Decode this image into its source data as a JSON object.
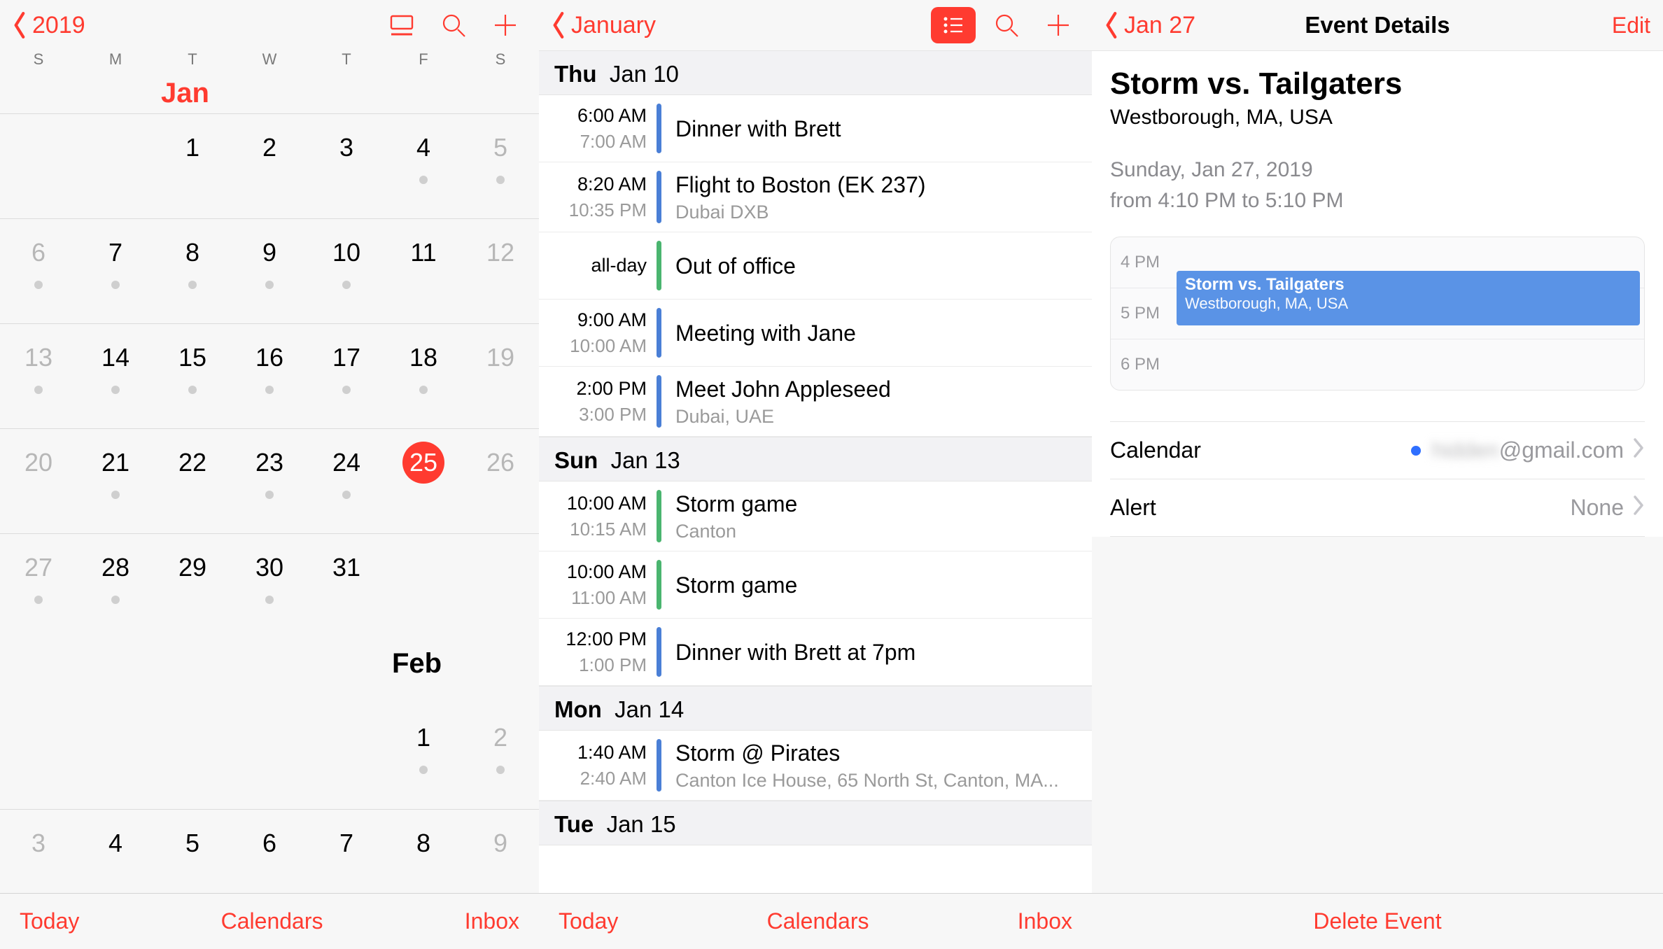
{
  "pane1": {
    "back_label": "2019",
    "weekdays": [
      "S",
      "M",
      "T",
      "W",
      "T",
      "F",
      "S"
    ],
    "month_jan": "Jan",
    "month_feb": "Feb",
    "weeks": [
      {
        "cells": [
          {
            "d": "",
            "dot": false,
            "grey": false
          },
          {
            "d": "",
            "dot": false,
            "grey": false
          },
          {
            "d": "1",
            "dot": false,
            "grey": false
          },
          {
            "d": "2",
            "dot": false,
            "grey": false
          },
          {
            "d": "3",
            "dot": false,
            "grey": false
          },
          {
            "d": "4",
            "dot": true,
            "grey": false
          },
          {
            "d": "5",
            "dot": true,
            "grey": true
          }
        ]
      },
      {
        "cells": [
          {
            "d": "6",
            "dot": true,
            "grey": true
          },
          {
            "d": "7",
            "dot": true,
            "grey": false
          },
          {
            "d": "8",
            "dot": true,
            "grey": false
          },
          {
            "d": "9",
            "dot": true,
            "grey": false
          },
          {
            "d": "10",
            "dot": true,
            "grey": false
          },
          {
            "d": "11",
            "dot": false,
            "grey": false
          },
          {
            "d": "12",
            "dot": false,
            "grey": true
          }
        ]
      },
      {
        "cells": [
          {
            "d": "13",
            "dot": true,
            "grey": true
          },
          {
            "d": "14",
            "dot": true,
            "grey": false
          },
          {
            "d": "15",
            "dot": true,
            "grey": false
          },
          {
            "d": "16",
            "dot": true,
            "grey": false
          },
          {
            "d": "17",
            "dot": true,
            "grey": false
          },
          {
            "d": "18",
            "dot": true,
            "grey": false
          },
          {
            "d": "19",
            "dot": false,
            "grey": true
          }
        ]
      },
      {
        "cells": [
          {
            "d": "20",
            "dot": false,
            "grey": true
          },
          {
            "d": "21",
            "dot": true,
            "grey": false
          },
          {
            "d": "22",
            "dot": false,
            "grey": false
          },
          {
            "d": "23",
            "dot": true,
            "grey": false
          },
          {
            "d": "24",
            "dot": true,
            "grey": false
          },
          {
            "d": "25",
            "dot": false,
            "grey": false,
            "today": true
          },
          {
            "d": "26",
            "dot": false,
            "grey": true
          }
        ]
      },
      {
        "cells": [
          {
            "d": "27",
            "dot": true,
            "grey": true
          },
          {
            "d": "28",
            "dot": true,
            "grey": false
          },
          {
            "d": "29",
            "dot": false,
            "grey": false
          },
          {
            "d": "30",
            "dot": true,
            "grey": false
          },
          {
            "d": "31",
            "dot": false,
            "grey": false
          },
          {
            "d": "",
            "dot": false,
            "grey": false
          },
          {
            "d": "",
            "dot": false,
            "grey": false
          }
        ]
      }
    ],
    "feb_week1": [
      {
        "d": "",
        "dot": false
      },
      {
        "d": "",
        "dot": false
      },
      {
        "d": "",
        "dot": false
      },
      {
        "d": "",
        "dot": false
      },
      {
        "d": "",
        "dot": false
      },
      {
        "d": "1",
        "dot": true,
        "grey": false
      },
      {
        "d": "2",
        "dot": true,
        "grey": true
      }
    ],
    "feb_week2": [
      {
        "d": "3",
        "dot": false,
        "grey": true
      },
      {
        "d": "4",
        "dot": false
      },
      {
        "d": "5",
        "dot": false
      },
      {
        "d": "6",
        "dot": false
      },
      {
        "d": "7",
        "dot": false
      },
      {
        "d": "8",
        "dot": false
      },
      {
        "d": "9",
        "dot": false,
        "grey": true
      }
    ],
    "footer": {
      "today": "Today",
      "calendars": "Calendars",
      "inbox": "Inbox"
    }
  },
  "pane2": {
    "back_label": "January",
    "days": [
      {
        "header_day": "Thu",
        "header_date": "Jan 10",
        "events": [
          {
            "t1": "6:00 AM",
            "t2": "7:00 AM",
            "bar": "blue",
            "title": "Dinner with Brett",
            "loc": ""
          },
          {
            "t1": "8:20 AM",
            "t2": "10:35 PM",
            "bar": "blue",
            "title": "Flight to Boston (EK 237)",
            "loc": "Dubai DXB"
          },
          {
            "t1": "all-day",
            "t2": "",
            "bar": "green",
            "title": "Out of office",
            "loc": ""
          },
          {
            "t1": "9:00 AM",
            "t2": "10:00 AM",
            "bar": "blue",
            "title": "Meeting with Jane",
            "loc": ""
          },
          {
            "t1": "2:00 PM",
            "t2": "3:00 PM",
            "bar": "blue",
            "title": "Meet John Appleseed",
            "loc": "Dubai, UAE"
          }
        ]
      },
      {
        "header_day": "Sun",
        "header_date": "Jan 13",
        "events": [
          {
            "t1": "10:00 AM",
            "t2": "10:15 AM",
            "bar": "green",
            "title": "Storm game",
            "loc": "Canton"
          },
          {
            "t1": "10:00 AM",
            "t2": "11:00 AM",
            "bar": "green",
            "title": "Storm game",
            "loc": ""
          },
          {
            "t1": "12:00 PM",
            "t2": "1:00 PM",
            "bar": "blue",
            "title": "Dinner with Brett at 7pm",
            "loc": ""
          }
        ]
      },
      {
        "header_day": "Mon",
        "header_date": "Jan 14",
        "events": [
          {
            "t1": "1:40 AM",
            "t2": "2:40 AM",
            "bar": "blue",
            "title": "Storm @ Pirates",
            "loc": "Canton Ice House, 65 North St, Canton, MA..."
          }
        ]
      },
      {
        "header_day": "Tue",
        "header_date": "Jan 15",
        "events": []
      }
    ],
    "footer": {
      "today": "Today",
      "calendars": "Calendars",
      "inbox": "Inbox"
    }
  },
  "pane3": {
    "back_label": "Jan 27",
    "title": "Event Details",
    "edit": "Edit",
    "event": {
      "title": "Storm vs. Tailgaters",
      "loc": "Westborough, MA, USA",
      "date": "Sunday, Jan 27, 2019",
      "time": "from 4:10 PM to 5:10 PM"
    },
    "timeline": {
      "labels": [
        "4 PM",
        "5 PM",
        "6 PM"
      ],
      "ev_title": "Storm vs. Tailgaters",
      "ev_loc": "Westborough, MA, USA"
    },
    "calendar_label": "Calendar",
    "calendar_value_hidden": "hidden",
    "calendar_value_suffix": "@gmail.com",
    "alert_label": "Alert",
    "alert_value": "None",
    "delete": "Delete Event"
  }
}
